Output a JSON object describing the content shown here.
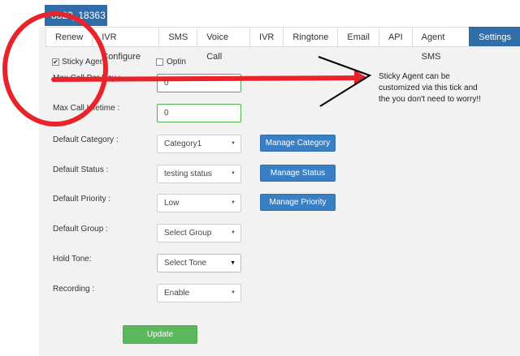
{
  "header": {
    "number": "8820_18363"
  },
  "tabs": [
    {
      "label": "Renew",
      "active": false
    },
    {
      "label": "IVR Configure",
      "active": false
    },
    {
      "label": "SMS",
      "active": false
    },
    {
      "label": "Voice Call",
      "active": false
    },
    {
      "label": "IVR",
      "active": false
    },
    {
      "label": "Ringtone",
      "active": false
    },
    {
      "label": "Email",
      "active": false
    },
    {
      "label": "API",
      "active": false
    },
    {
      "label": "Agent SMS",
      "active": false
    },
    {
      "label": "Settings",
      "active": true
    }
  ],
  "form": {
    "sticky_agent": {
      "label": "Sticky Agent",
      "checked": true
    },
    "optin": {
      "label": "Optin",
      "checked": false
    },
    "max_call_per_day": {
      "label": "Max Call Per Day :",
      "value": "0"
    },
    "max_call_lifetime": {
      "label": "Max Call Lifetime :",
      "value": "0"
    },
    "default_category": {
      "label": "Default Category :",
      "value": "Category1",
      "manage_label": "Manage Category"
    },
    "default_status": {
      "label": "Default Status :",
      "value": "testing status",
      "manage_label": "Manage Status"
    },
    "default_priority": {
      "label": "Default Priority :",
      "value": "Low",
      "manage_label": "Manage Priority"
    },
    "default_group": {
      "label": "Default Group :",
      "value": "Select Group"
    },
    "hold_tone": {
      "label": "Hold Tone:",
      "value": "Select Tone"
    },
    "recording": {
      "label": "Recording :",
      "value": "Enable"
    },
    "update_label": "Update"
  },
  "annotation": {
    "lines": [
      "Sticky Agent can be",
      "customized via this tick and",
      "the you don't need to worry!!"
    ]
  },
  "colors": {
    "tab_active": "#2f6ea8",
    "button_blue": "#3a7ec4",
    "button_green": "#5cb85c",
    "annotation_red": "#e8242a"
  }
}
